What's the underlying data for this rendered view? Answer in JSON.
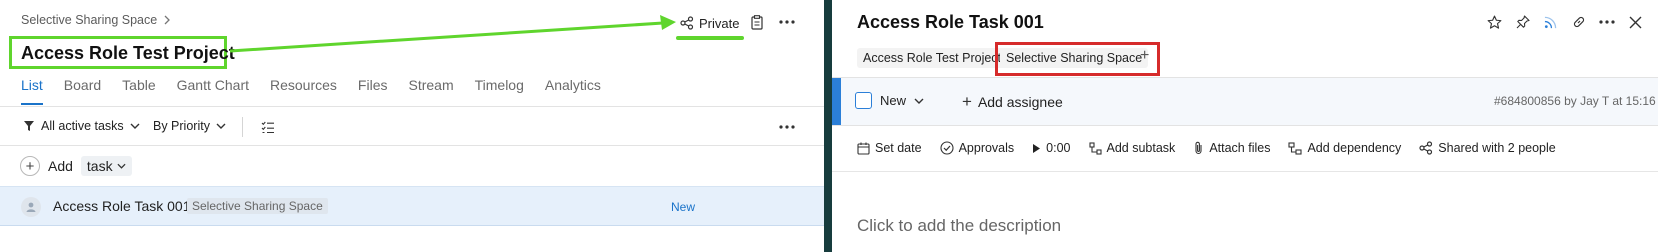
{
  "left": {
    "breadcrumb": "Selective Sharing Space",
    "project_title": "Access Role Test Project",
    "private_label": "Private",
    "tabs": [
      "List",
      "Board",
      "Table",
      "Gantt Chart",
      "Resources",
      "Files",
      "Stream",
      "Timelog",
      "Analytics"
    ],
    "active_tab": "List",
    "filters": {
      "active_tasks": "All active tasks",
      "priority": "By Priority"
    },
    "add_row": {
      "add_label": "Add",
      "type_label": "task"
    },
    "task": {
      "title": "Access Role Task 001",
      "space_chip": "Selective Sharing Space",
      "status": "New"
    }
  },
  "right": {
    "title": "Access Role Task 001",
    "tags": [
      "Access Role Test Project",
      "Selective Sharing Space"
    ],
    "status_label": "New",
    "add_assignee": "Add assignee",
    "meta": "#684800856 by Jay T at 15:16",
    "actions": {
      "set_date": "Set date",
      "approvals": "Approvals",
      "timer": "0:00",
      "add_subtask": "Add subtask",
      "attach_files": "Attach files",
      "add_dependency": "Add dependency",
      "shared_with": "Shared with 2 people"
    },
    "description_placeholder": "Click to add the description"
  },
  "colors": {
    "accent": "#1a73c9",
    "highlight_green": "#5fd52d",
    "highlight_red": "#d62b2b",
    "divider": "#173c3d",
    "selected_row": "#e6f0fb"
  }
}
